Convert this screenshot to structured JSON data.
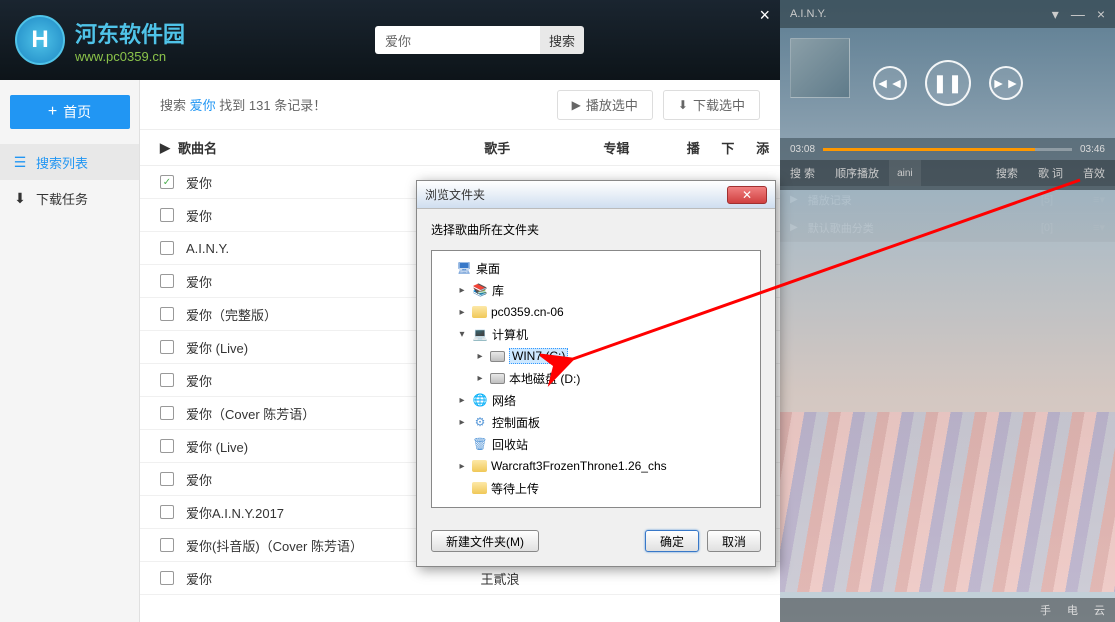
{
  "logo": {
    "title": "河东软件园",
    "url": "www.pc0359.cn",
    "letter": "H"
  },
  "header": {
    "search_value": "爱你",
    "search_btn": "搜索",
    "close": "×"
  },
  "sidebar": {
    "home": "首页",
    "items": [
      {
        "label": "搜索列表",
        "active": true
      },
      {
        "label": "下载任务",
        "active": false
      }
    ]
  },
  "content": {
    "result_prefix": "搜索",
    "result_kw": "爱你",
    "result_mid": "找到",
    "result_count": "131",
    "result_suffix": "条记录！",
    "play_selected": "播放选中",
    "download_selected": "下载选中",
    "columns": {
      "name": "歌曲名",
      "artist": "歌手",
      "album": "专辑",
      "play": "播",
      "down": "下",
      "add": "添"
    },
    "songs": [
      {
        "checked": true,
        "name": "爱你"
      },
      {
        "checked": false,
        "name": "爱你"
      },
      {
        "checked": false,
        "name": "A.I.N.Y."
      },
      {
        "checked": false,
        "name": "爱你"
      },
      {
        "checked": false,
        "name": "爱你（完整版）"
      },
      {
        "checked": false,
        "name": "爱你 (Live)"
      },
      {
        "checked": false,
        "name": "爱你"
      },
      {
        "checked": false,
        "name": "爱你（Cover 陈芳语）"
      },
      {
        "checked": false,
        "name": "爱你 (Live)"
      },
      {
        "checked": false,
        "name": "爱你"
      },
      {
        "checked": false,
        "name": "爱你A.I.N.Y.2017"
      },
      {
        "checked": false,
        "name": "爱你(抖音版)（Cover 陈芳语）"
      },
      {
        "checked": false,
        "name": "爱你"
      }
    ],
    "visible_artist": "王貳浪"
  },
  "player": {
    "title": "A.I.N.Y.",
    "time_current": "03:08",
    "time_total": "03:46",
    "tabs": [
      "搜 索",
      "顺序播放",
      "aini",
      "搜索",
      "歌 词",
      "音效"
    ],
    "playlist": [
      {
        "label": "播放记录",
        "count": "[5]"
      },
      {
        "label": "默认歌曲分类",
        "count": "[0]"
      }
    ],
    "footer": [
      "手",
      "电",
      "云"
    ]
  },
  "dialog": {
    "title": "浏览文件夹",
    "message": "选择歌曲所在文件夹",
    "tree": [
      {
        "label": "桌面",
        "indent": 0,
        "icon": "desktop",
        "arrow": "none"
      },
      {
        "label": "库",
        "indent": 1,
        "icon": "lib",
        "arrow": "right"
      },
      {
        "label": "pc0359.cn-06",
        "indent": 1,
        "icon": "folder",
        "arrow": "right"
      },
      {
        "label": "计算机",
        "indent": 1,
        "icon": "computer",
        "arrow": "down"
      },
      {
        "label": "WIN7 (C:)",
        "indent": 2,
        "icon": "drive",
        "arrow": "right",
        "selected": true
      },
      {
        "label": "本地磁盘 (D:)",
        "indent": 2,
        "icon": "drive",
        "arrow": "right"
      },
      {
        "label": "网络",
        "indent": 1,
        "icon": "network",
        "arrow": "right"
      },
      {
        "label": "控制面板",
        "indent": 1,
        "icon": "control",
        "arrow": "right"
      },
      {
        "label": "回收站",
        "indent": 1,
        "icon": "recycle",
        "arrow": "none"
      },
      {
        "label": "Warcraft3FrozenThrone1.26_chs",
        "indent": 1,
        "icon": "folder",
        "arrow": "right"
      },
      {
        "label": "等待上传",
        "indent": 1,
        "icon": "folder",
        "arrow": "none"
      }
    ],
    "new_folder": "新建文件夹(M)",
    "ok": "确定",
    "cancel": "取消"
  }
}
